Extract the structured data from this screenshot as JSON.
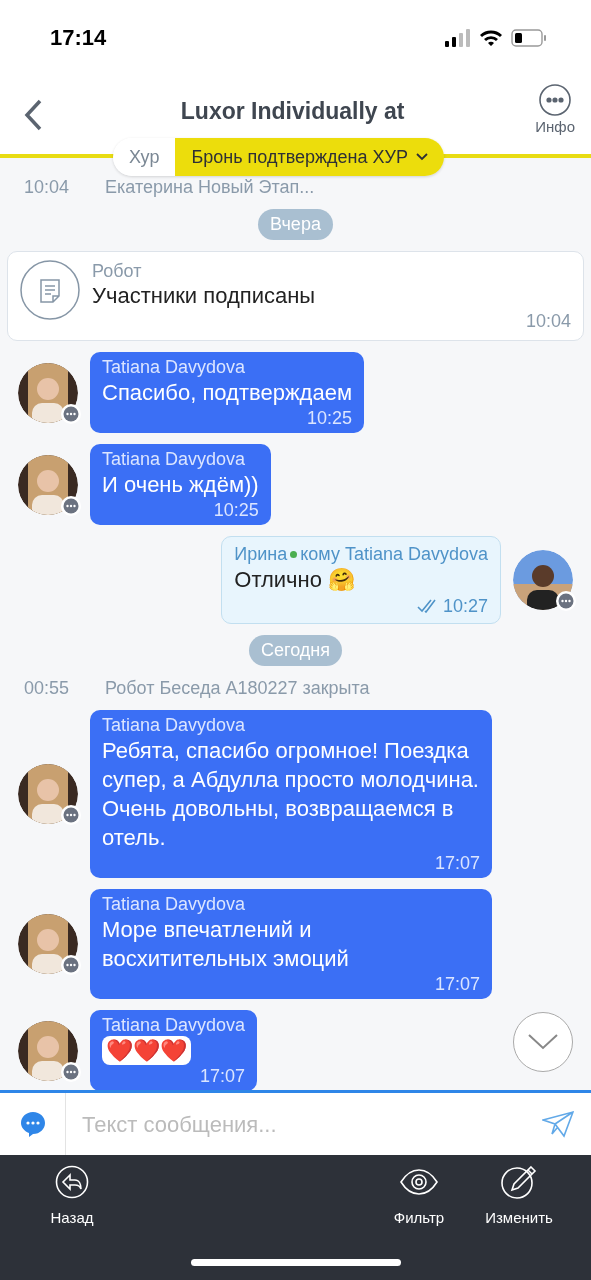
{
  "status_bar": {
    "time": "17:14"
  },
  "header": {
    "title": "Luxor Individually at",
    "info_label": "Инфо"
  },
  "status_pill": {
    "left": "Хур",
    "right": "Бронь подтверждена ХУР"
  },
  "messages": [
    {
      "kind": "system",
      "time": "10:04",
      "text": "Екатерина Новый Этап..."
    },
    {
      "kind": "date",
      "text": "Вчера"
    },
    {
      "kind": "robot",
      "sender": "Робот",
      "text": "Участники подписаны",
      "time": "10:04"
    },
    {
      "kind": "incoming",
      "sender": "Tatiana Davydova",
      "text": "Спасибо, подтверждаем",
      "time": "10:25"
    },
    {
      "kind": "incoming",
      "sender": "Tatiana Davydova",
      "text": "И очень ждём))",
      "time": "10:25"
    },
    {
      "kind": "outgoing",
      "sender": "Ирина",
      "online": true,
      "recipient": "кому Tatiana Davydova",
      "text": "Отлично 🤗",
      "time": "10:27",
      "read": true
    },
    {
      "kind": "date",
      "text": "Сегодня"
    },
    {
      "kind": "system",
      "time": "00:55",
      "text": "Робот Беседа А180227 закрыта"
    },
    {
      "kind": "incoming",
      "sender": "Tatiana Davydova",
      "text": "Ребята, спасибо огромное! Поездка супер, а Абдулла просто молодчина. Очень довольны, возвращаемся в отель.",
      "time": "17:07"
    },
    {
      "kind": "incoming",
      "sender": "Tatiana Davydova",
      "text": "Море впечатлений и восхитительных эмоций",
      "time": "17:07"
    },
    {
      "kind": "incoming_emoji",
      "sender": "Tatiana Davydova",
      "text": "❤️❤️❤️",
      "time": "17:07"
    }
  ],
  "composer": {
    "placeholder": "Текст сообщения..."
  },
  "bottom_bar": [
    {
      "kind": "back",
      "label": "Назад"
    },
    {
      "kind": "filter",
      "label": "Фильтр"
    },
    {
      "kind": "edit",
      "label": "Изменить"
    }
  ]
}
